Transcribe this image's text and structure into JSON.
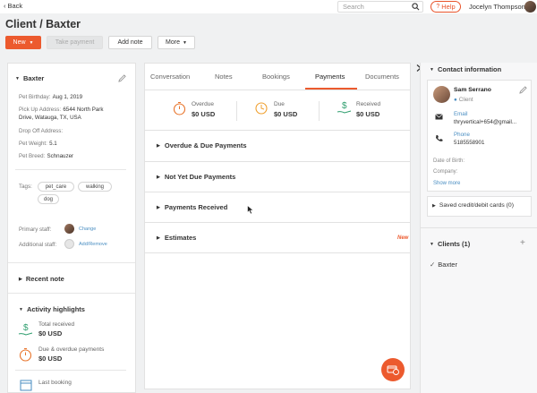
{
  "topbar": {
    "back_label": "Back",
    "search_placeholder": "Search",
    "help_label": "Help",
    "user_name": "Jocelyn Thompson"
  },
  "header": {
    "title": "Client / Baxter",
    "new_label": "New",
    "take_payment_label": "Take payment",
    "add_note_label": "Add note",
    "more_label": "More"
  },
  "left": {
    "pet_name": "Baxter",
    "fields": [
      {
        "label": "Pet Birthday:",
        "value": "Aug 1, 2019"
      },
      {
        "label": "Pick Up Address:",
        "value": "6544 North Park"
      },
      {
        "label": "",
        "value": "Drive, Watauga, TX, USA"
      },
      {
        "label": "Drop Off Address:",
        "value": ""
      },
      {
        "label": "Pet Weight:",
        "value": "5.1"
      },
      {
        "label": "Pet Breed:",
        "value": "Schnauzer"
      }
    ],
    "tags_label": "Tags:",
    "tags": [
      "pet_care",
      "walking",
      "dog"
    ],
    "primary_staff_label": "Primary staff:",
    "change_label": "Change",
    "additional_staff_label": "Additional staff:",
    "add_remove_label": "Add/Remove",
    "recent_note_title": "Recent note",
    "activity_title": "Activity highlights",
    "total_received_label": "Total received",
    "total_received_value": "$0 USD",
    "due_label": "Due & overdue payments",
    "due_value": "$0 USD",
    "last_booking_label": "Last booking"
  },
  "center": {
    "tabs": [
      "Conversation",
      "Notes",
      "Bookings",
      "Payments",
      "Documents"
    ],
    "active_tab": "Payments",
    "metrics": [
      {
        "label": "Overdue",
        "value": "$0 USD"
      },
      {
        "label": "Due",
        "value": "$0 USD"
      },
      {
        "label": "Received",
        "value": "$0 USD"
      }
    ],
    "sections": [
      "Overdue & Due Payments",
      "Not Yet Due Payments",
      "Payments Received",
      "Estimates"
    ],
    "new_badge": "New",
    "colors": {
      "accent": "#ec5a2e",
      "received": "#2e9e6e"
    }
  },
  "right": {
    "contact_title": "Contact information",
    "contact_name": "Sam Serrano",
    "contact_role": "Client",
    "email_label": "Email",
    "email_value": "thryvertical+654@gmail...",
    "phone_label": "Phone",
    "phone_value": "5185558901",
    "dob_label": "Date of Birth:",
    "company_label": "Company:",
    "show_more": "Show more",
    "cards_title": "Saved credit/debit cards (0)",
    "clients_title": "Clients (1)",
    "client_item": "Baxter"
  }
}
